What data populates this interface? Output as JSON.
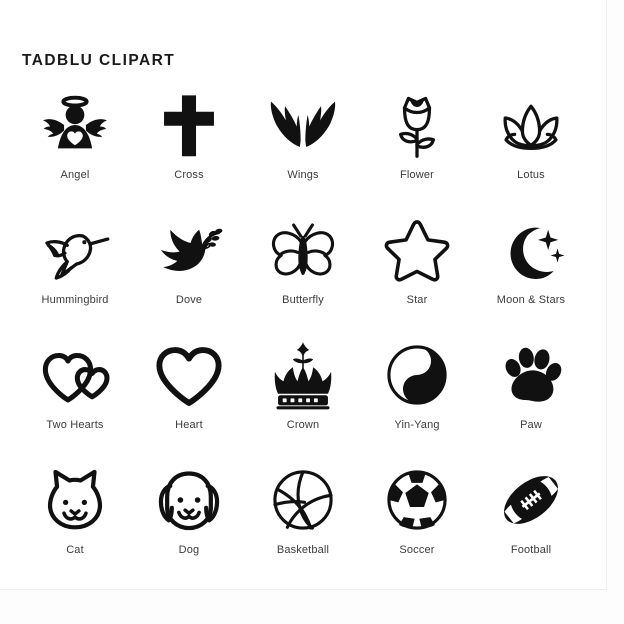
{
  "header": {
    "title": "TADBLU CLIPART"
  },
  "colors": {
    "ink": "#111111",
    "background": "#ffffff",
    "label": "#3b3b3b",
    "card_border": "#efefef"
  },
  "grid": {
    "columns": 5,
    "rows": 4,
    "total_items": 20
  },
  "items": [
    {
      "icon": "angel-icon",
      "label": "Angel"
    },
    {
      "icon": "cross-icon",
      "label": "Cross"
    },
    {
      "icon": "wings-icon",
      "label": "Wings"
    },
    {
      "icon": "flower-icon",
      "label": "Flower"
    },
    {
      "icon": "lotus-icon",
      "label": "Lotus"
    },
    {
      "icon": "hummingbird-icon",
      "label": "Hummingbird"
    },
    {
      "icon": "dove-icon",
      "label": "Dove"
    },
    {
      "icon": "butterfly-icon",
      "label": "Butterfly"
    },
    {
      "icon": "star-icon",
      "label": "Star"
    },
    {
      "icon": "moon-stars-icon",
      "label": "Moon & Stars"
    },
    {
      "icon": "two-hearts-icon",
      "label": "Two Hearts"
    },
    {
      "icon": "heart-icon",
      "label": "Heart"
    },
    {
      "icon": "crown-icon",
      "label": "Crown"
    },
    {
      "icon": "yin-yang-icon",
      "label": "Yin-Yang"
    },
    {
      "icon": "paw-icon",
      "label": "Paw"
    },
    {
      "icon": "cat-icon",
      "label": "Cat"
    },
    {
      "icon": "dog-icon",
      "label": "Dog"
    },
    {
      "icon": "basketball-icon",
      "label": "Basketball"
    },
    {
      "icon": "soccer-icon",
      "label": "Soccer"
    },
    {
      "icon": "football-icon",
      "label": "Football"
    }
  ]
}
